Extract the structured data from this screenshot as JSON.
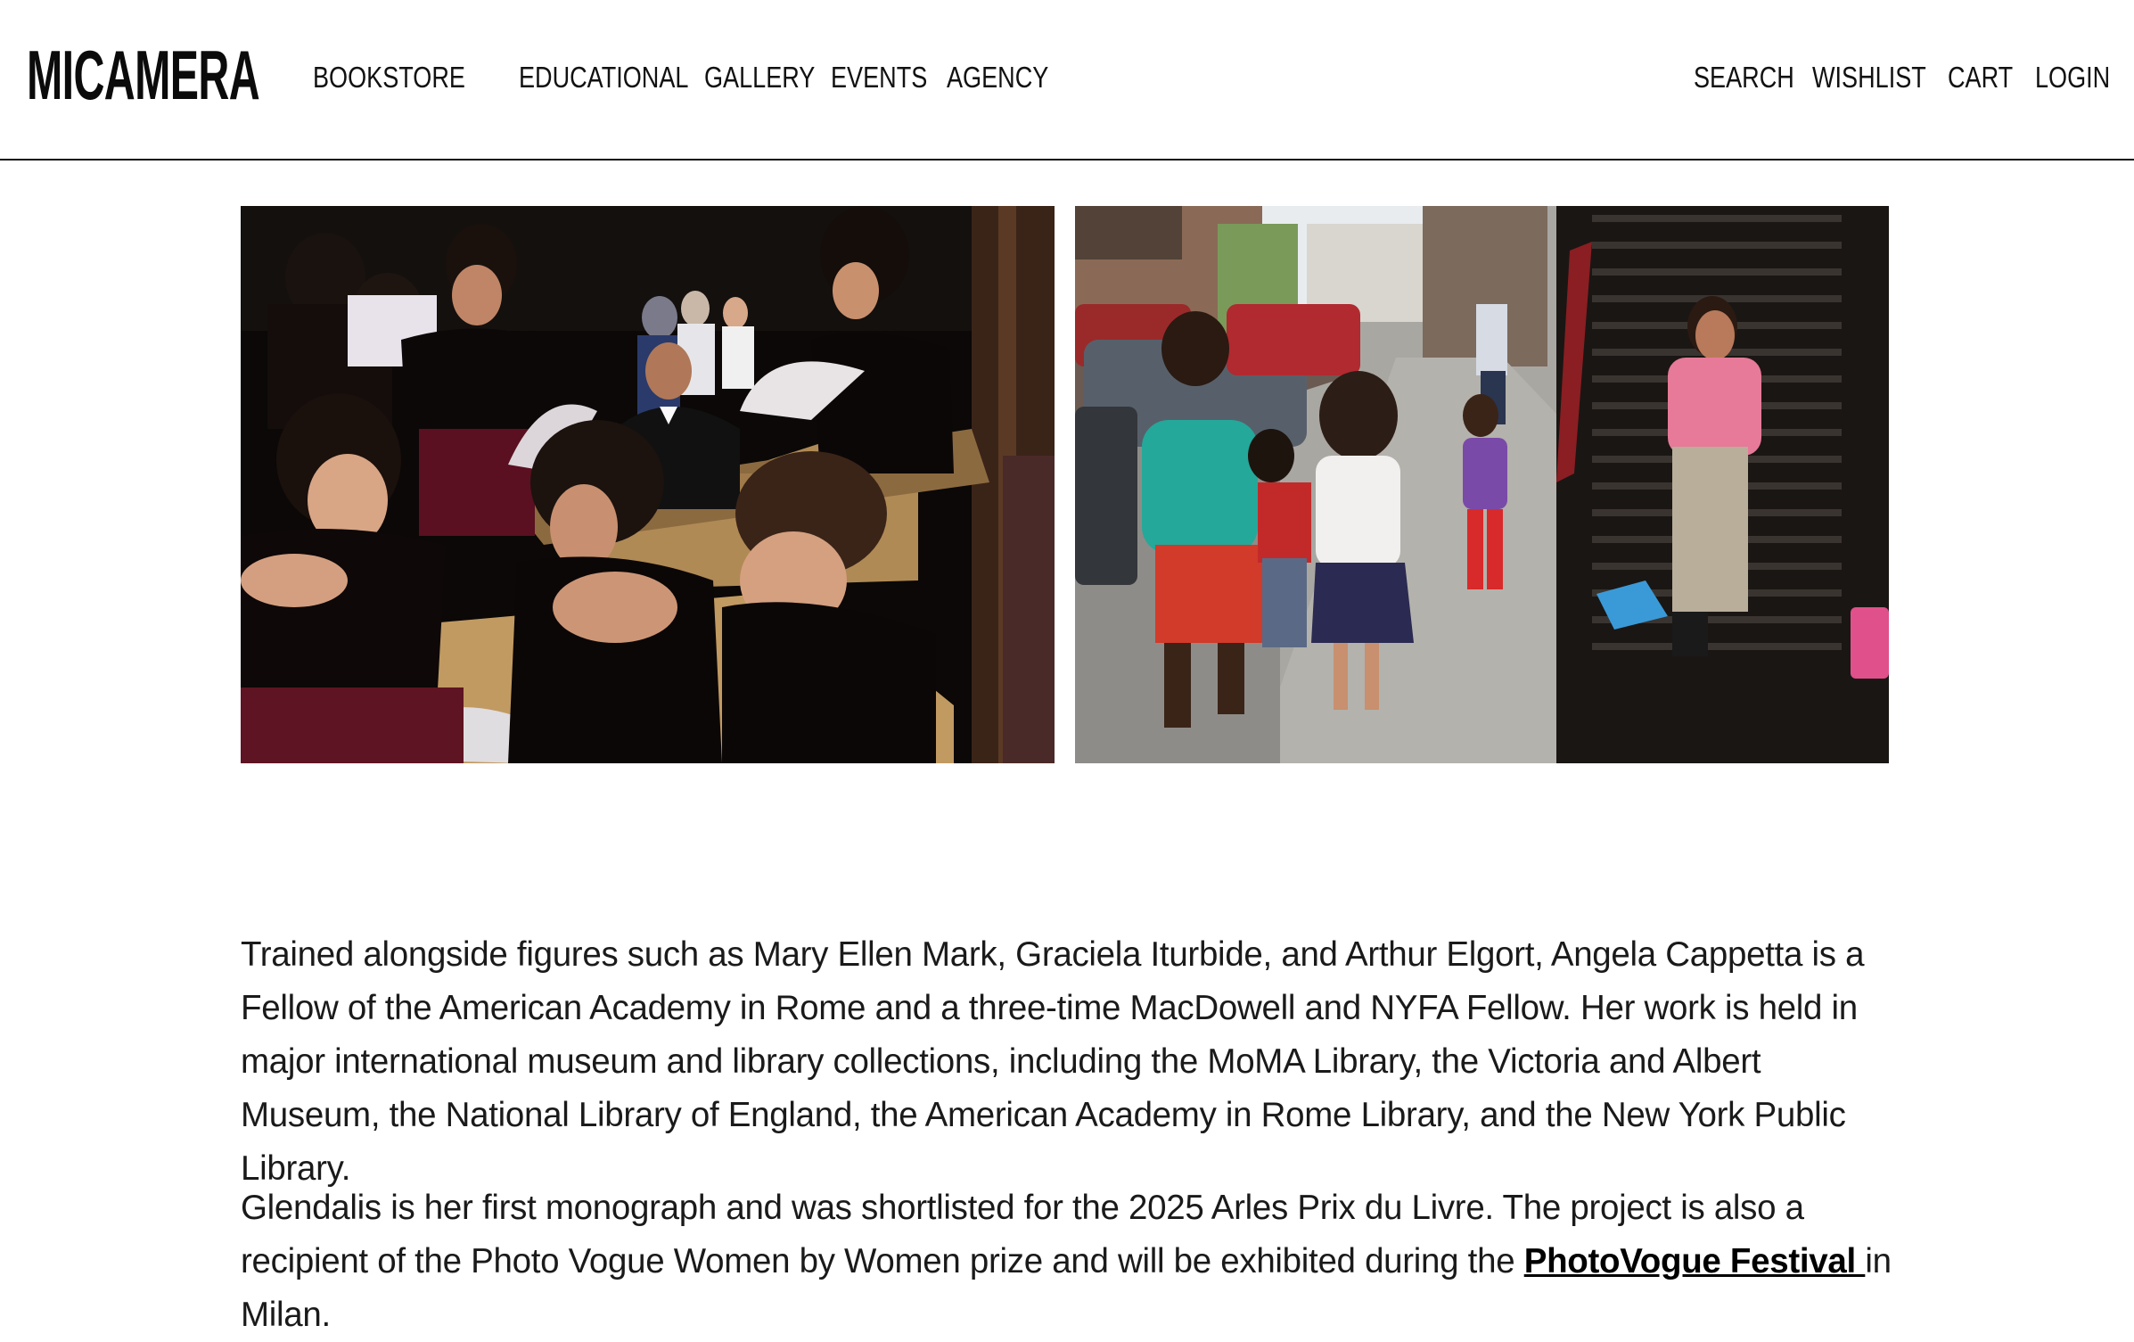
{
  "header": {
    "logo": "MICAMERA",
    "nav_left": [
      "BOOKSTORE",
      "EDUCATIONAL",
      "GALLERY",
      "EVENTS",
      "AGENCY"
    ],
    "nav_right": [
      "SEARCH",
      "WISHLIST",
      "CART",
      "LOGIN"
    ]
  },
  "photos": [
    {
      "name": "photo-quinceanera-church"
    },
    {
      "name": "photo-street-children"
    }
  ],
  "article": {
    "paragraph1": "Trained alongside figures such as Mary Ellen Mark, Graciela Iturbide, and Arthur Elgort, Angela Cappetta is a Fellow of the American Academy in Rome and a three-time MacDowell and NYFA Fellow. Her work is held in major international museum and library collections, including the MoMA Library, the Victoria and Albert Museum, the National Library of England, the American Academy in Rome Library, and the New York Public Library.",
    "paragraph2_before": "Glendalis is her first monograph and was shortlisted for the 2025 Arles Prix du Livre. The project is also a recipient of the Photo Vogue Women by Women prize and will be exhibited during the ",
    "paragraph2_link": "PhotoVogue Festival ",
    "paragraph2_after": "in Milan."
  }
}
